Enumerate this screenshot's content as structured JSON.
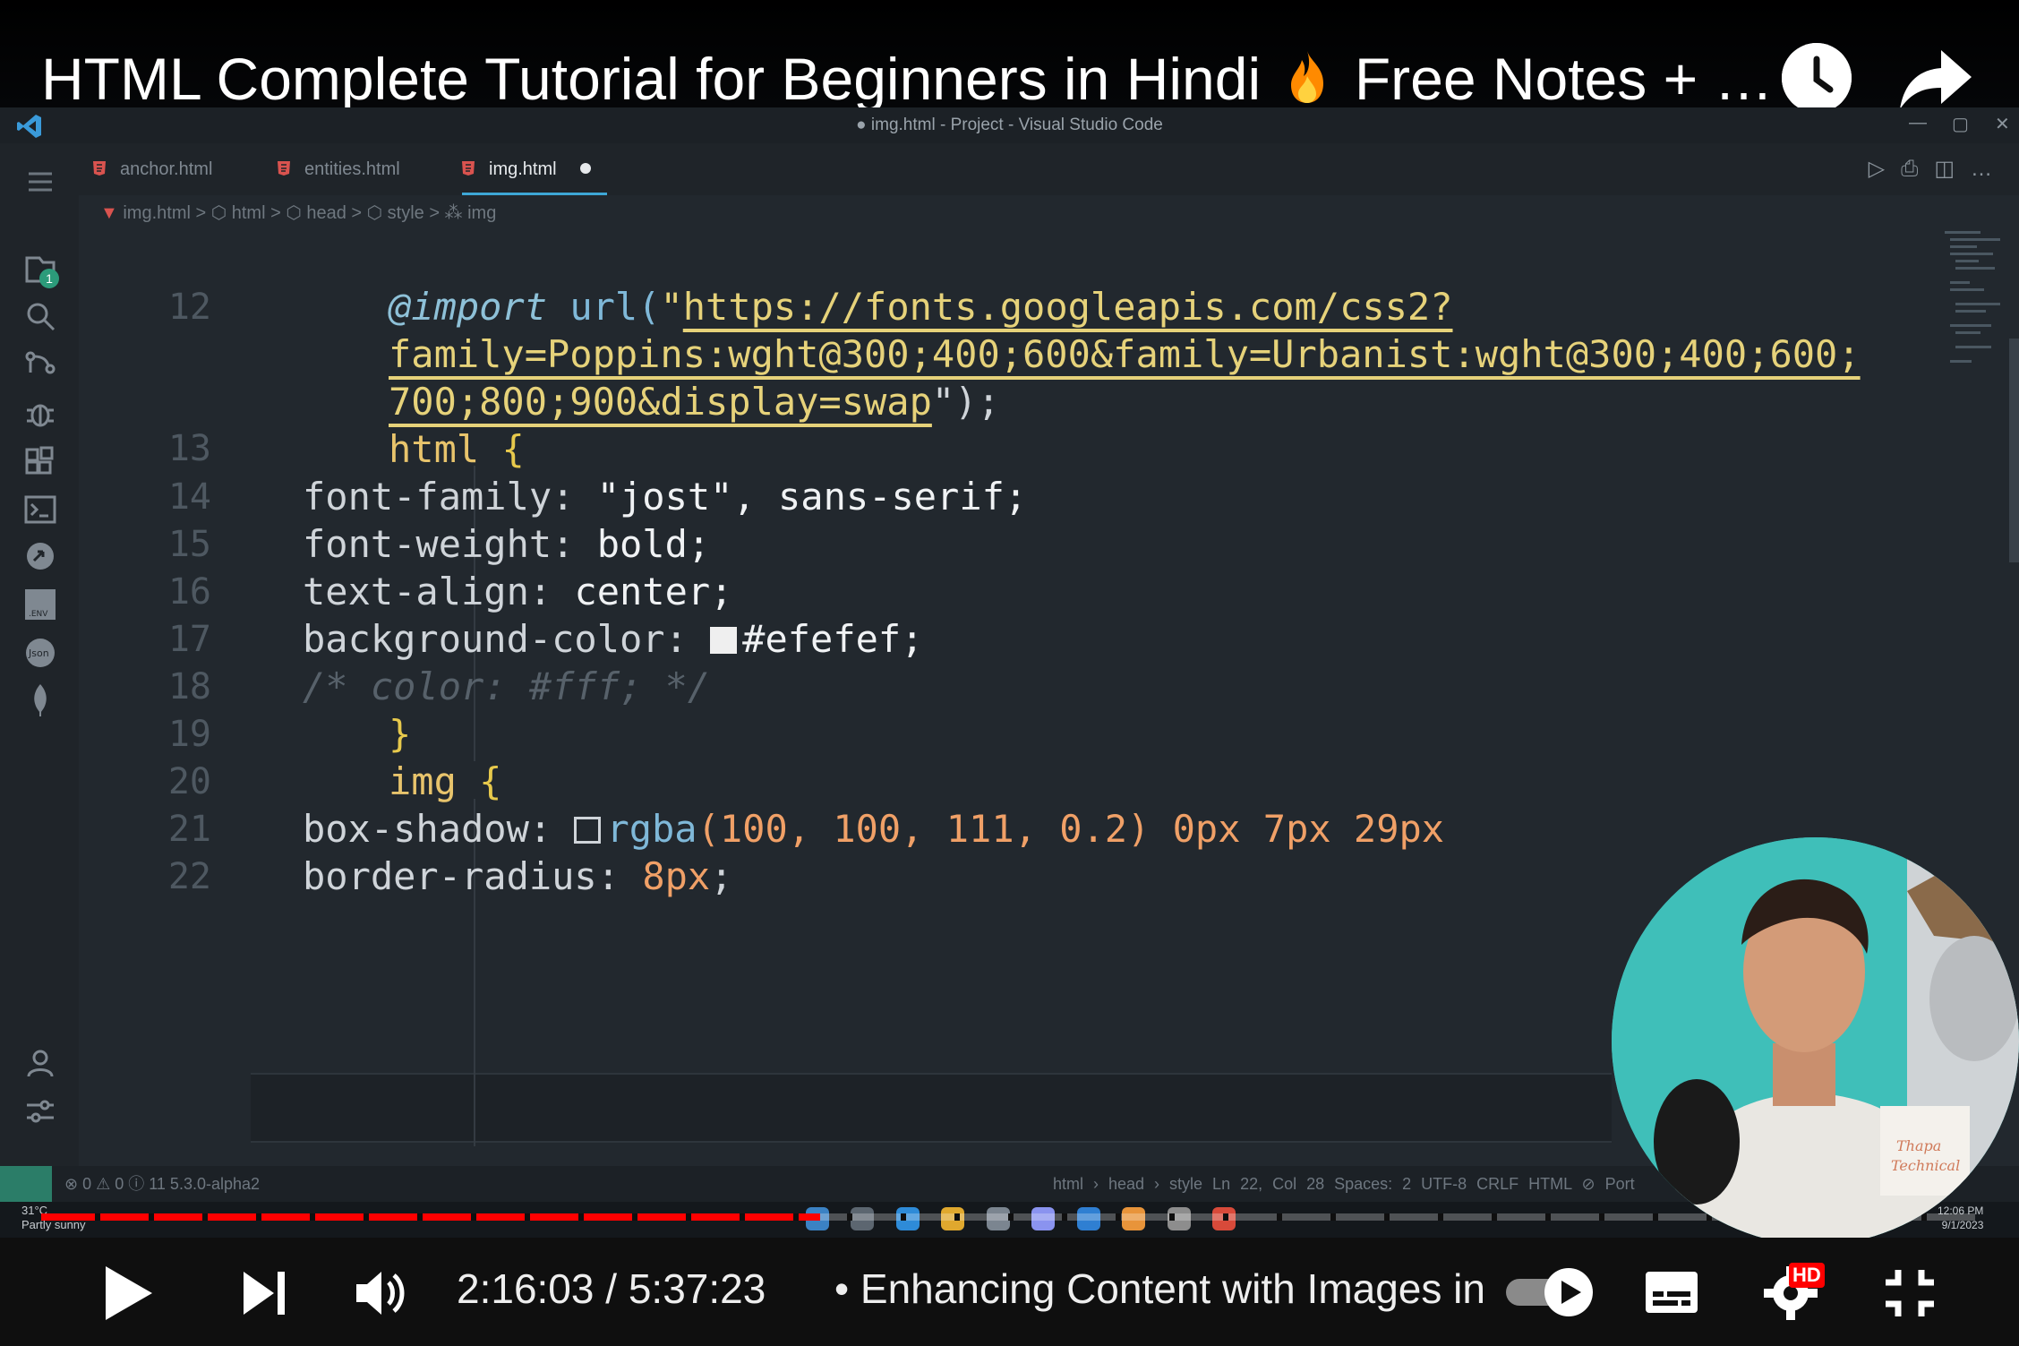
{
  "video": {
    "title": "HTML Complete Tutorial for Beginners in Hindi",
    "title_suffix": "Free Notes + …",
    "time_current": "2:16:03",
    "time_separator": "/",
    "time_total": "5:37:23",
    "chapter": "• Enhancing Content with Images in",
    "progress_fraction": 0.403,
    "hd_badge": "HD",
    "accent_color": "#ff0000"
  },
  "vscode": {
    "window_title": "● img.html - Project - Visual Studio Code",
    "window_controls": [
      "—",
      "▢",
      "✕"
    ],
    "tabs": [
      {
        "label": "anchor.html",
        "active": false
      },
      {
        "label": "entities.html",
        "active": false
      },
      {
        "label": "img.html",
        "active": true,
        "modified": true
      }
    ],
    "breadcrumb": [
      "img.html",
      "html",
      "head",
      "style",
      "img"
    ],
    "breadcrumb_text": "img.html  >  ⬡ html  >  ⬡ head  >  ⬡ style  >  ⁂ img",
    "explorer_badge": "1",
    "lines": [
      {
        "n": "12"
      },
      {
        "n": "13"
      },
      {
        "n": "14"
      },
      {
        "n": "15"
      },
      {
        "n": "16"
      },
      {
        "n": "17"
      },
      {
        "n": "18"
      },
      {
        "n": "19"
      },
      {
        "n": "20"
      },
      {
        "n": "21"
      },
      {
        "n": "22"
      }
    ],
    "code": {
      "import_kw": "@import",
      "url_fn": "url(",
      "url_1": "https://fonts.googleapis.com/css2?",
      "url_2": "family=Poppins:wght@300;400;600&family=Urbanist:wght@300;400;600;",
      "url_3": "700;800;900&display=swap",
      "url_end": "\");",
      "html_sel": "html",
      "font_family_prop": "font-family:",
      "font_family_val": "\"jost\"",
      "font_family_rest": ", sans-serif;",
      "font_weight_prop": "font-weight:",
      "font_weight_val": "bold;",
      "text_align_prop": "text-align:",
      "text_align_val": "center;",
      "bg_prop": "background-color:",
      "bg_val": "#efefef;",
      "bg_swatch_color": "#efefef",
      "comment": "/* color: #fff; */",
      "close_brace": "}",
      "img_sel": "img",
      "box_shadow_prop": "box-shadow:",
      "rgba_fn": "rgba",
      "rgba_args": "(100, 100, 111, 0.2)",
      "box_shadow_rest": "0px 7px 29px",
      "border_radius_prop": "border-radius:",
      "border_radius_val": "8px",
      "semicolon": ";"
    },
    "status": {
      "left": "⊗ 0 ⚠ 0 ⓘ 11    5.3.0-alpha2",
      "right": "html › head › style    Ln 22, Col 28    Spaces: 2    UTF-8    CRLF    HTML    ⊘ Port"
    }
  },
  "taskbar": {
    "weather_temp": "31°C",
    "weather_text": "Partly sunny",
    "clock_time": "12:06 PM",
    "clock_date": "9/1/2023"
  },
  "icons": {
    "watch_later": "clock-icon",
    "share": "share-arrow-icon",
    "play": "play-icon",
    "next": "next-icon",
    "volume": "volume-icon",
    "autoplay": "autoplay-toggle-icon",
    "captions": "captions-icon",
    "settings": "settings-gear-icon",
    "fullscreen_exit": "exit-fullscreen-icon"
  }
}
